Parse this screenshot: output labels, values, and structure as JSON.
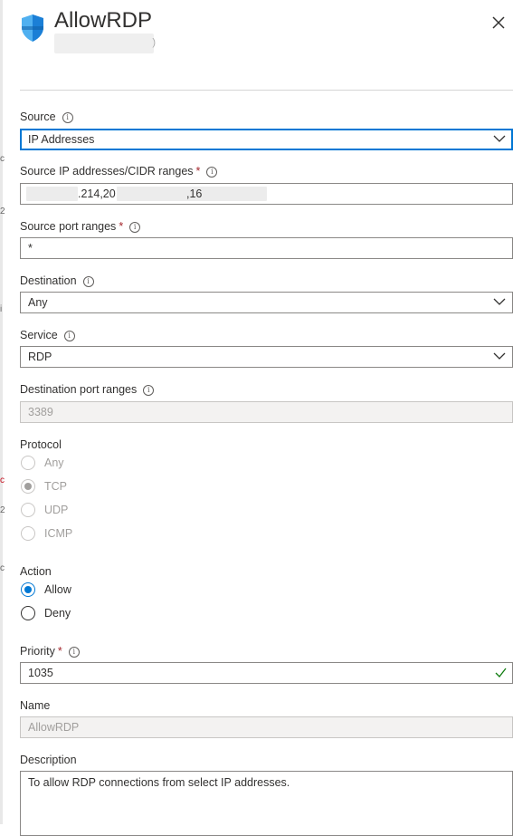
{
  "header": {
    "title": "AllowRDP",
    "subtitle_tail": ")"
  },
  "edge_chars": [
    "c",
    "2",
    "i",
    "c",
    "2",
    "c"
  ],
  "source": {
    "label": "Source",
    "value": "IP Addresses"
  },
  "source_ip": {
    "label": "Source IP addresses/CIDR ranges",
    "required": "*",
    "frag1": ".214,20",
    "frag2": ",16"
  },
  "source_port": {
    "label": "Source port ranges",
    "required": "*",
    "value": "*"
  },
  "destination": {
    "label": "Destination",
    "value": "Any"
  },
  "service": {
    "label": "Service",
    "value": "RDP"
  },
  "dest_port": {
    "label": "Destination port ranges",
    "value": "3389"
  },
  "protocol": {
    "label": "Protocol",
    "options": [
      "Any",
      "TCP",
      "UDP",
      "ICMP"
    ],
    "selected": "TCP"
  },
  "action": {
    "label": "Action",
    "options": [
      "Allow",
      "Deny"
    ],
    "selected": "Allow"
  },
  "priority": {
    "label": "Priority",
    "required": "*",
    "value": "1035"
  },
  "name": {
    "label": "Name",
    "value": "AllowRDP"
  },
  "description": {
    "label": "Description",
    "value": "To allow RDP connections from select IP addresses."
  },
  "colors": {
    "accent": "#0078d4",
    "required": "#a4262c",
    "valid": "#107c10"
  }
}
